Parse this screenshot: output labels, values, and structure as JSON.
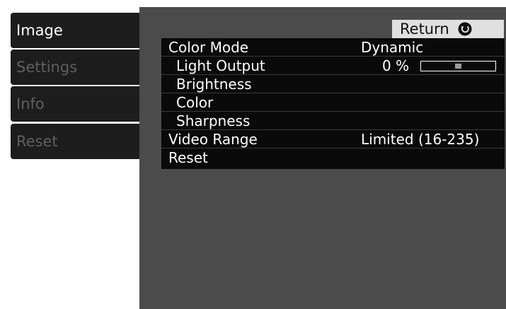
{
  "tabs": [
    {
      "label": "Image",
      "active": true
    },
    {
      "label": "Settings",
      "active": false
    },
    {
      "label": "Info",
      "active": false
    },
    {
      "label": "Reset",
      "active": false
    }
  ],
  "return_button": {
    "label": "Return",
    "icon": "return-arrow-icon"
  },
  "menu": {
    "color_mode": {
      "label": "Color Mode",
      "value": "Dynamic"
    },
    "light_output": {
      "label": "Light Output",
      "value": "0 %",
      "level_percent": 50
    },
    "brightness": {
      "label": "Brightness"
    },
    "color": {
      "label": "Color"
    },
    "sharpness": {
      "label": "Sharpness"
    },
    "video_range": {
      "label": "Video Range",
      "value": "Limited (16-235)"
    },
    "reset": {
      "label": "Reset"
    }
  },
  "colors": {
    "tab_background": "#1d1d1d",
    "panel_background": "#4b4b4b",
    "menu_background": "#0a0a0a",
    "active_text": "#ffffff",
    "inactive_text": "#5f5f5f",
    "return_background": "#e0e0e0"
  }
}
